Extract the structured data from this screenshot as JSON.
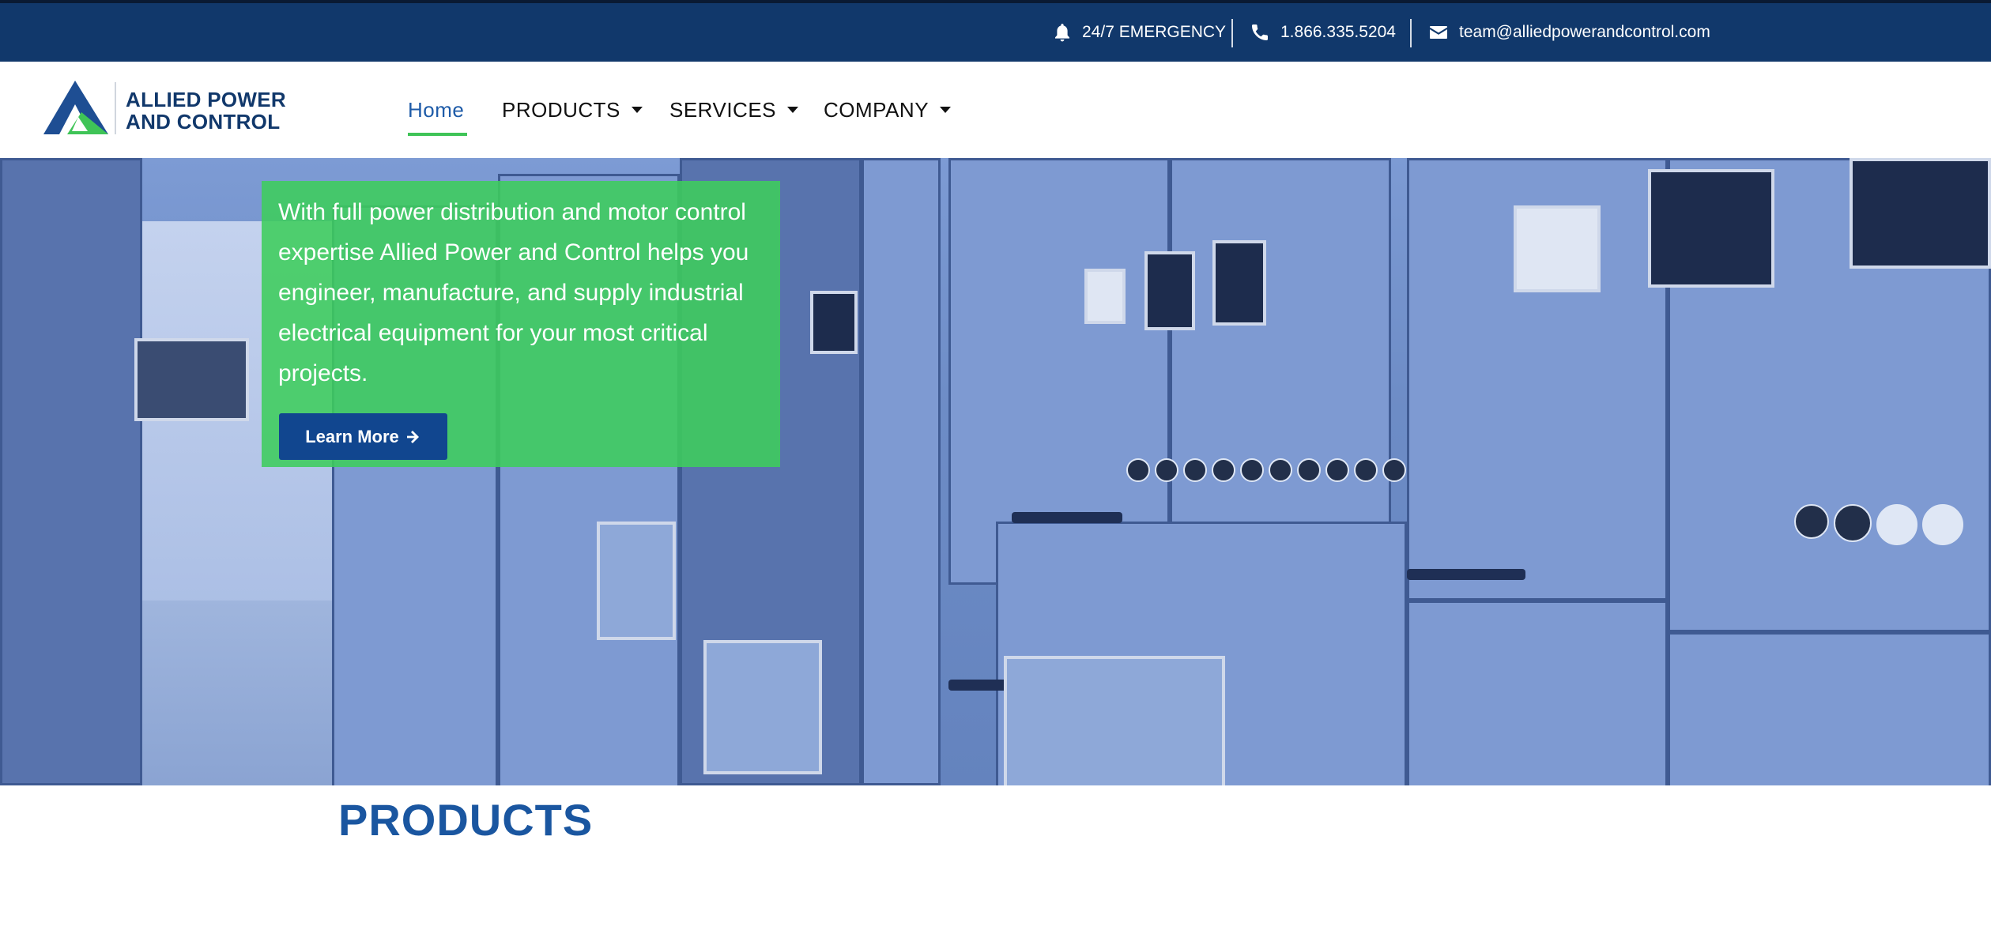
{
  "topbar": {
    "emergency": "24/7 EMERGENCY",
    "phone": "1.866.335.5204",
    "email": "team@alliedpowerandcontrol.com"
  },
  "logo": {
    "line1": "ALLIED POWER",
    "line2": "AND CONTROL"
  },
  "nav": {
    "home": "Home",
    "products": "PRODUCTS",
    "services": "SERVICES",
    "company": "COMPANY"
  },
  "hero": {
    "text": "With full power distribution and motor control expertise Allied Power and Control helps you engineer, manufacture, and supply industrial electrical equipment for your most critical projects.",
    "button": "Learn More"
  },
  "section": {
    "title": "PRODUCTS"
  },
  "colors": {
    "topbar": "#11386b",
    "accent_green": "#3fc457",
    "brand_blue": "#1a56a0"
  },
  "icons": [
    "bell-icon",
    "phone-icon",
    "envelope-icon",
    "caret-down-icon",
    "arrow-right-icon"
  ]
}
